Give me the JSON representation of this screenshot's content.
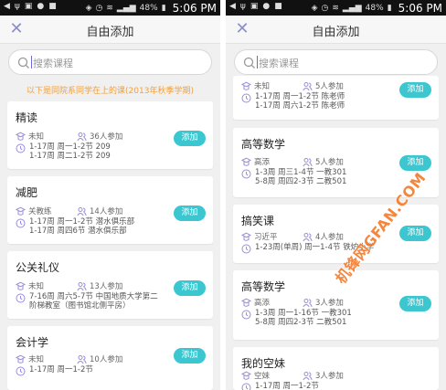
{
  "accent": "#3cc6cf",
  "notice_color": "#f0a040",
  "left": {
    "status": {
      "time": "5:06 PM",
      "battery": "48%"
    },
    "title": "自由添加",
    "search": {
      "placeholder": "搜索课程"
    },
    "notice": "以下是同院系同学在上的课(2013年秋季学期)",
    "courses": [
      {
        "name": "精读",
        "teacher": "未知",
        "count": "36人参加",
        "times": [
          "1-17周 周一1-2节 209",
          "1-17周 周二1-2节 209"
        ],
        "add": "添加"
      },
      {
        "name": "减肥",
        "teacher": "关教练",
        "count": "14人参加",
        "times": [
          "1-17周 周一1-2节 潜水俱乐部",
          "1-17周 周四6节 潜水俱乐部"
        ],
        "add": "添加"
      },
      {
        "name": "公关礼仪",
        "teacher": "未知",
        "count": "13人参加",
        "times": [
          "7-16周 周六5-7节 中国地质大学第二",
          "阶梯教室（图书馆北侧平房）"
        ],
        "add": "添加"
      },
      {
        "name": "会计学",
        "teacher": "未知",
        "count": "10人参加",
        "times": [
          "1-17周 周一1-2节"
        ],
        "add": "添加"
      }
    ]
  },
  "right": {
    "status": {
      "time": "5:06 PM",
      "battery": "48%"
    },
    "title": "自由添加",
    "search": {
      "placeholder": "搜索课程"
    },
    "courses": [
      {
        "name": "",
        "teacher": "未知",
        "count": "5人参加",
        "times": [
          "1-17周 周一1-2节 陈老师",
          "1-17周 周六1-2节 陈老师"
        ],
        "add": "添加"
      },
      {
        "name": "高等数学",
        "teacher": "高添",
        "count": "5人参加",
        "times": [
          "1-3周 周三1-4节 一教301",
          "5-8周 周四2-3节 二教501"
        ],
        "add": "添加"
      },
      {
        "name": "搞笑课",
        "teacher": "习近平",
        "count": "4人参加",
        "times": [
          "1-23周(单周) 周一1-4节 铁炉小学"
        ],
        "add": "添加"
      },
      {
        "name": "高等数学",
        "teacher": "高添",
        "count": "3人参加",
        "times": [
          "1-3周 周一1-16节 一教301",
          "5-8周 周四2-3节 二教501"
        ],
        "add": "添加"
      },
      {
        "name": "我的空妹",
        "teacher": "空妹",
        "count": "3人参加",
        "times": [
          "1-17周 周一1-2节"
        ],
        "add": "添加"
      }
    ]
  },
  "watermark": "机锋网GFAN.COM"
}
